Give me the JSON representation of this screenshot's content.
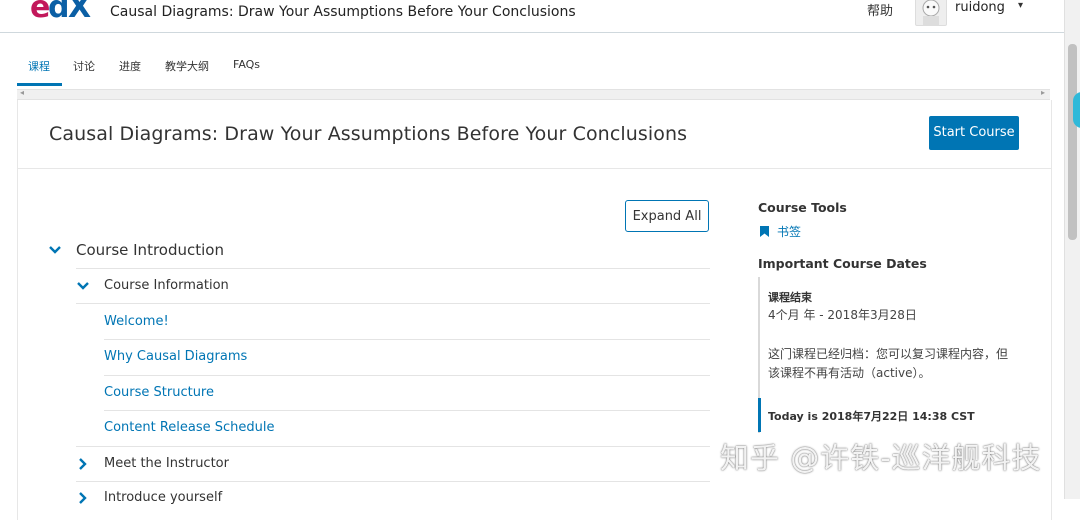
{
  "header": {
    "logo_text": "edX",
    "course_title": "Causal Diagrams: Draw Your Assumptions Before Your Conclusions",
    "help": "帮助",
    "username": "ruidong",
    "caret": "▾"
  },
  "tabs": [
    {
      "label": "课程",
      "active": true
    },
    {
      "label": "讨论",
      "active": false
    },
    {
      "label": "进度",
      "active": false
    },
    {
      "label": "教学大纲",
      "active": false
    },
    {
      "label": "FAQs",
      "active": false
    }
  ],
  "main": {
    "title": "Causal Diagrams: Draw Your Assumptions Before Your Conclusions",
    "start_button": "Start Course",
    "expand_all": "Expand All",
    "outline": {
      "section": "Course Introduction",
      "subsections": [
        {
          "title": "Course Information",
          "expanded": true,
          "units": [
            "Welcome!",
            "Why Causal Diagrams",
            "Course Structure",
            "Content Release Schedule"
          ]
        },
        {
          "title": "Meet the Instructor",
          "expanded": false
        },
        {
          "title": "Introduce yourself",
          "expanded": false
        }
      ]
    }
  },
  "sidebar": {
    "tools_heading": "Course Tools",
    "bookmarks": "书签",
    "dates_heading": "Important Course Dates",
    "end_label": "课程结束",
    "end_value": "4个月 年 - 2018年3月28日",
    "archive_note": "这门课程已经归档：您可以复习课程内容，但该课程不再有活动（active）。",
    "today": "Today is 2018年7月22日 14:38 CST"
  },
  "watermark": "知乎 @许铁-巡洋舰科技",
  "colors": {
    "accent": "#0075b4",
    "logo_pink": "#c2185b",
    "logo_blue": "#0b5fa5"
  }
}
